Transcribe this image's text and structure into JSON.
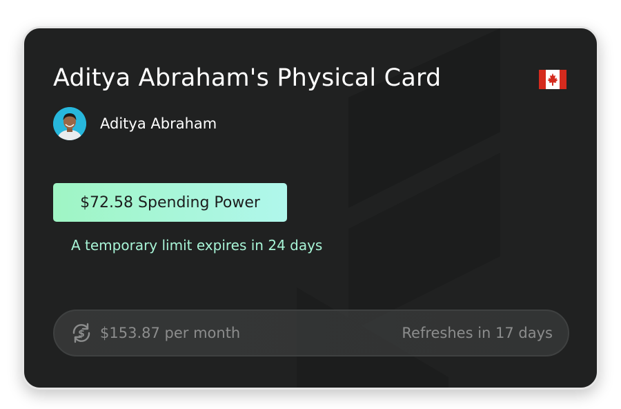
{
  "card": {
    "title": "Aditya Abraham's Physical Card",
    "country_flag": "canada-flag-icon",
    "owner": {
      "name": "Aditya Abraham",
      "avatar": "user-avatar"
    },
    "spending_power": "$72.58 Spending Power",
    "temporary_limit_note": "A temporary limit expires in 24 days",
    "limit": {
      "icon": "refresh-dollar-icon",
      "amount": "$153.87 per month",
      "refresh": "Refreshes in 17 days"
    }
  },
  "colors": {
    "card_background": "#202121",
    "badge_gradient_start": "#9ff5c4",
    "badge_gradient_end": "#b0f7ec",
    "note_text": "#a8f5d7",
    "muted_text": "#8c8d8d",
    "flag_red": "#d52b1e"
  }
}
